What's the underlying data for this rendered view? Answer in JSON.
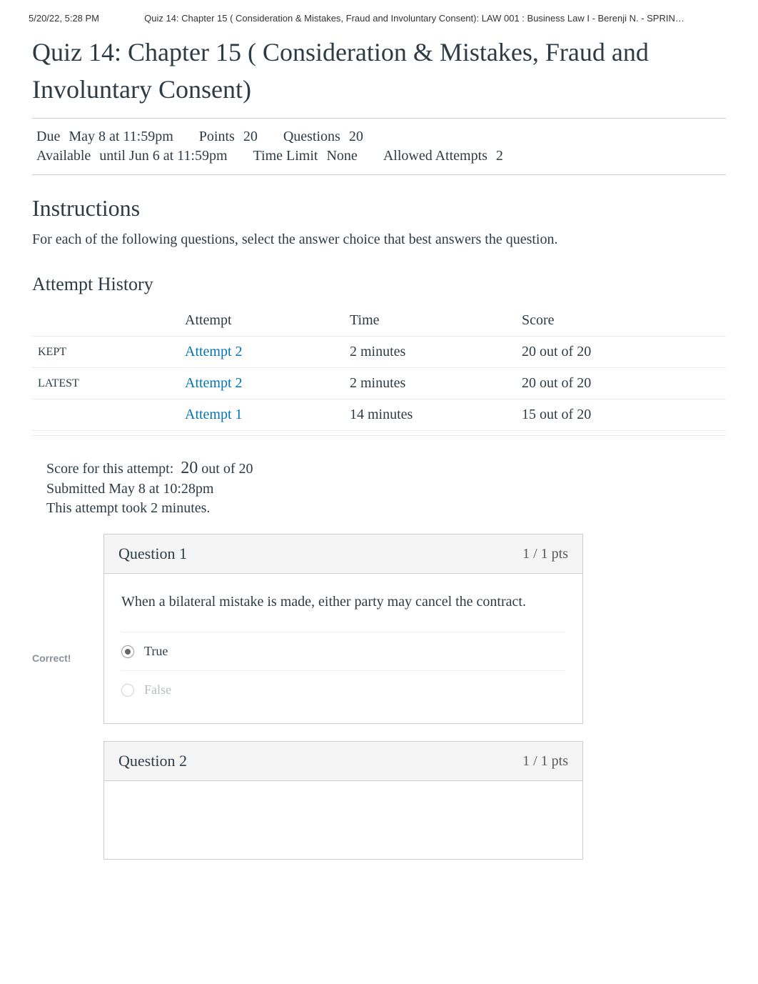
{
  "print_header": {
    "left": "5/20/22, 5:28 PM",
    "center": "Quiz 14: Chapter 15 ( Consideration & Mistakes, Fraud and Involuntary Consent): LAW 001 : Business Law I - Berenji N. - SPRIN…"
  },
  "title": "Quiz 14: Chapter 15 ( Consideration & Mistakes, Fraud and Involuntary Consent)",
  "meta": {
    "row1": {
      "due": {
        "label": "Due",
        "value": "May 8 at 11:59pm"
      },
      "points": {
        "label": "Points",
        "value": "20"
      },
      "questions": {
        "label": "Questions",
        "value": "20"
      }
    },
    "row2": {
      "available": {
        "label": "Available",
        "value": "until Jun 6 at 11:59pm"
      },
      "time_limit": {
        "label": "Time Limit",
        "value": "None"
      },
      "allowed_attempts": {
        "label": "Allowed Attempts",
        "value": "2"
      }
    }
  },
  "instructions": {
    "heading": "Instructions",
    "text": "For each of the following questions, select the answer choice that best answers the question."
  },
  "attempt_history": {
    "heading": "Attempt History",
    "columns": {
      "c0": "",
      "c1": "Attempt",
      "c2": "Time",
      "c3": "Score"
    },
    "rows": [
      {
        "status": "KEPT",
        "attempt": "Attempt 2",
        "time": "2 minutes",
        "score": "20 out of 20"
      },
      {
        "status": "LATEST",
        "attempt": "Attempt 2",
        "time": "2 minutes",
        "score": "20 out of 20"
      },
      {
        "status": "",
        "attempt": "Attempt 1",
        "time": "14 minutes",
        "score": "15 out of 20"
      }
    ]
  },
  "summary": {
    "score_label": "Score for this attempt:",
    "score_value": "20",
    "score_suffix": "out of 20",
    "submitted": "Submitted May 8 at 10:28pm",
    "duration": "This attempt took 2 minutes."
  },
  "question1": {
    "side_label": "Correct!",
    "title": "Question 1",
    "pts": "1 / 1 pts",
    "prompt": "When a bilateral mistake is made, either party may cancel the contract.",
    "answer_true": "True",
    "answer_false": "False"
  },
  "question2": {
    "title": "Question 2",
    "pts": "1 / 1 pts"
  }
}
